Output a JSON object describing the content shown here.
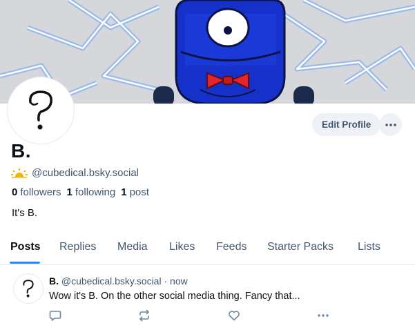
{
  "profile": {
    "display_name": "B.",
    "handle_icon": "sun-emoji-icon",
    "handle": "@cubedical.bsky.social",
    "followers_count": "0",
    "followers_label": "followers",
    "following_count": "1",
    "following_label": "following",
    "posts_count": "1",
    "posts_label": "post",
    "bio": "It's B."
  },
  "actions": {
    "edit_profile": "Edit Profile",
    "more_icon": "ellipsis-icon"
  },
  "tabs": [
    {
      "label": "Posts",
      "active": true
    },
    {
      "label": "Replies"
    },
    {
      "label": "Media"
    },
    {
      "label": "Likes"
    },
    {
      "label": "Feeds"
    },
    {
      "label": "Starter Packs"
    },
    {
      "label": "Lists"
    }
  ],
  "post": {
    "author_name": "B.",
    "author_handle": "@cubedical.bsky.social",
    "separator": "·",
    "time": "now",
    "text": "Wow it's B. On the other social media thing. Fancy that...",
    "action_icons": [
      "reply-icon",
      "repost-icon",
      "like-icon",
      "more-icon"
    ]
  },
  "colors": {
    "accent": "#208bfe",
    "muted_text": "#42576c",
    "button_bg": "#eef1f5"
  }
}
